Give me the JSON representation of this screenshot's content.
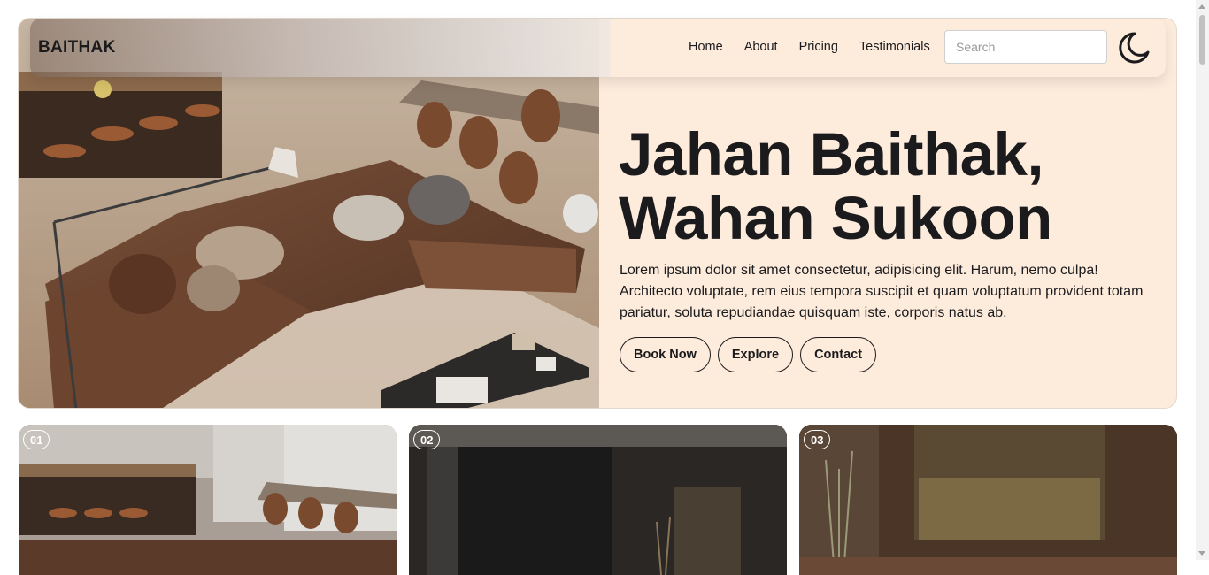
{
  "brand": "BAITHAK",
  "nav": {
    "links": [
      {
        "label": "Home"
      },
      {
        "label": "About"
      },
      {
        "label": "Pricing"
      },
      {
        "label": "Testimonials"
      }
    ],
    "search_placeholder": "Search",
    "theme_icon": "moon-icon"
  },
  "hero": {
    "title_line1": "Jahan Baithak,",
    "title_line2": "Wahan Sukoon",
    "description": "Lorem ipsum dolor sit amet consectetur, adipisicing elit. Harum, nemo culpa! Architecto voluptate, rem eius tempora suscipit et quam voluptatum provident totam pariatur, soluta repudiandae quisquam iste, corporis natus ab.",
    "buttons": [
      {
        "label": "Book Now"
      },
      {
        "label": "Explore"
      },
      {
        "label": "Contact"
      }
    ]
  },
  "cards": [
    {
      "number": "01"
    },
    {
      "number": "02"
    },
    {
      "number": "03"
    }
  ],
  "colors": {
    "hero_background": "#fdebdc",
    "text": "#1b1b1d"
  }
}
